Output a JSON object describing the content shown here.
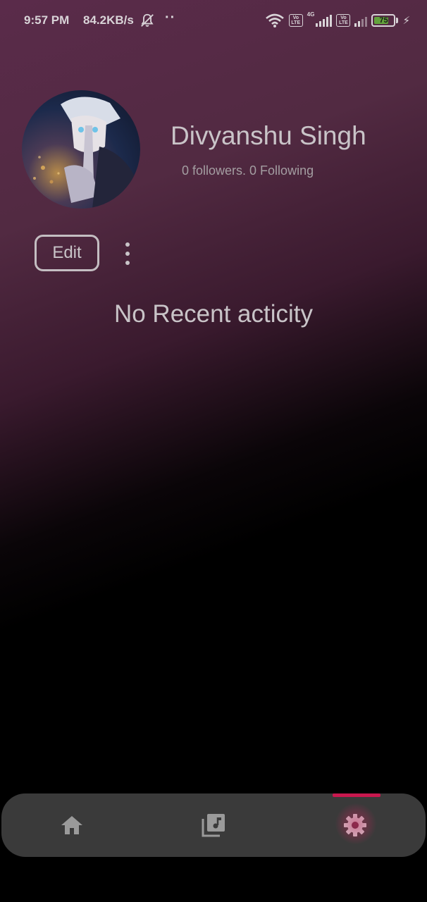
{
  "status_bar": {
    "time": "9:57 PM",
    "network_speed": "84.2KB/s",
    "dots": "··",
    "network_type": "4G",
    "volte_label": "Vo LTE",
    "battery_level": "75",
    "icons": [
      "bell-off-icon",
      "wifi-icon",
      "volte-icon",
      "signal-icon",
      "battery-icon",
      "charging-icon"
    ]
  },
  "profile": {
    "name": "Divyanshu Singh",
    "stats": "0 followers. 0 Following",
    "avatar_icon": "avatar-image"
  },
  "actions": {
    "edit_label": "Edit",
    "more_icon": "more-vertical-icon"
  },
  "main": {
    "empty_message": "No Recent acticity"
  },
  "bottom_nav": {
    "items": [
      {
        "icon": "home-icon",
        "active": false
      },
      {
        "icon": "music-library-icon",
        "active": false
      },
      {
        "icon": "settings-icon",
        "active": true
      }
    ],
    "accent_color": "#c8184e"
  },
  "colors": {
    "header_gradient": "#5a2b4a",
    "background": "#000000",
    "nav_background": "#3a3a3a",
    "text": "#c9c4c8",
    "battery_fill": "#63a33c"
  }
}
